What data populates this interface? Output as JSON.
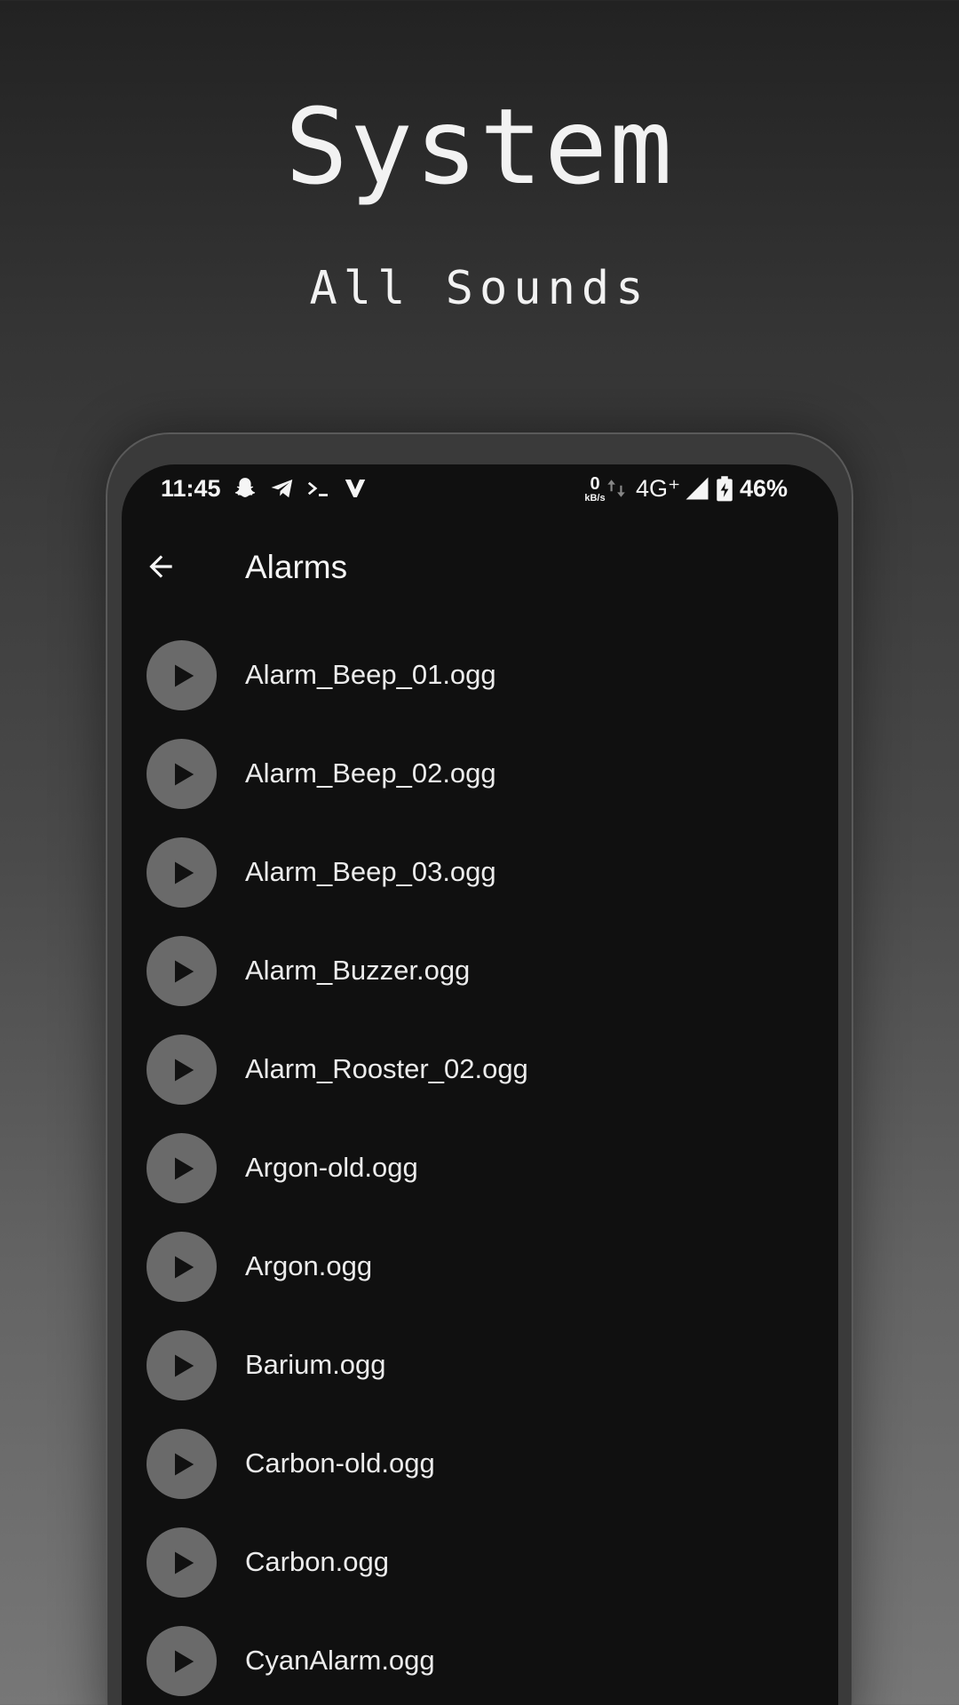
{
  "promo": {
    "title": "System",
    "subtitle": "All Sounds"
  },
  "status_bar": {
    "time": "11:45",
    "notification_icons": [
      "snapchat-icon",
      "telegram-icon",
      "terminal-icon",
      "vivaldi-icon"
    ],
    "net_speed_value": "0",
    "net_speed_unit": "kB/s",
    "network_type": "4G⁺",
    "battery_percent": "46%"
  },
  "app_bar": {
    "title": "Alarms"
  },
  "sounds": [
    {
      "name": "Alarm_Beep_01.ogg"
    },
    {
      "name": "Alarm_Beep_02.ogg"
    },
    {
      "name": "Alarm_Beep_03.ogg"
    },
    {
      "name": "Alarm_Buzzer.ogg"
    },
    {
      "name": "Alarm_Rooster_02.ogg"
    },
    {
      "name": "Argon-old.ogg"
    },
    {
      "name": "Argon.ogg"
    },
    {
      "name": "Barium.ogg"
    },
    {
      "name": "Carbon-old.ogg"
    },
    {
      "name": "Carbon.ogg"
    },
    {
      "name": "CyanAlarm.ogg"
    }
  ],
  "colors": {
    "screen_background": "#101010",
    "play_button": "#6a6a6a",
    "text": "#ececec"
  }
}
